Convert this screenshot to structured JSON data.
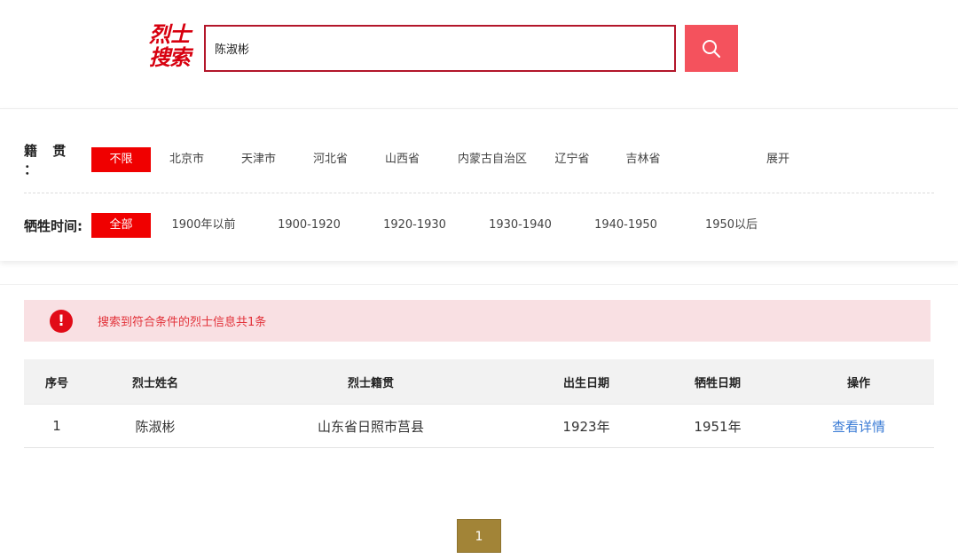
{
  "header": {
    "logo_line1": "烈士",
    "logo_line2": "搜索",
    "search_value": "陈淑彬",
    "search_icon": "search-icon"
  },
  "filters": {
    "origin_label": "籍 贯 ：",
    "origin_options": [
      "不限",
      "北京市",
      "天津市",
      "河北省",
      "山西省",
      "内蒙古自治区",
      "辽宁省",
      "吉林省"
    ],
    "expand_label": "展开",
    "time_label": "牺牲时间:",
    "time_options": [
      "全部",
      "1900年以前",
      "1900-1920",
      "1920-1930",
      "1930-1940",
      "1940-1950",
      "1950以后"
    ]
  },
  "alert": {
    "icon": "exclamation-icon",
    "text": "搜索到符合条件的烈士信息共1条"
  },
  "table": {
    "headers": [
      "序号",
      "烈士姓名",
      "烈士籍贯",
      "出生日期",
      "牺牲日期",
      "操作"
    ],
    "rows": [
      {
        "index": "1",
        "name": "陈淑彬",
        "origin": "山东省日照市莒县",
        "birth": "1923年",
        "death": "1951年",
        "action": "查看详情"
      }
    ]
  },
  "pagination": {
    "current_page": "1"
  },
  "colors": {
    "brand_red": "#d7000f",
    "chip_active": "#f00000",
    "search_button": "#f4525d",
    "alert_bg": "#f9e0e3",
    "link": "#3a7bd5",
    "page_button": "#a28437"
  }
}
